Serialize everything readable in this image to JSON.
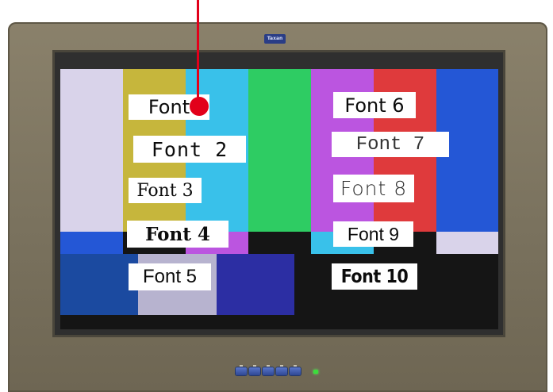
{
  "monitor": {
    "brand_logo": "Taxan",
    "bezel_color": "#7d7560"
  },
  "color_bars": {
    "top_row": [
      "#d9d3ea",
      "#c6b63c",
      "#39c1ea",
      "#2ecc63",
      "#bb55e0",
      "#df3a3c",
      "#2457d6"
    ],
    "middle_row": [
      "#2457d6",
      "#151515",
      "#bb55e0",
      "#151515",
      "#39c1ea",
      "#151515",
      "#d9d3ea"
    ],
    "bottom_blocks": [
      "#1b4aa0",
      "#b7b3cf",
      "#2c2ea3",
      "#151515"
    ]
  },
  "font_labels": {
    "font_1": "Font",
    "font_2": "Font 2",
    "font_3": "Font 3",
    "font_4": "Font 4",
    "font_5": "Font 5",
    "font_6": "Font 6",
    "font_7": "Font 7",
    "font_8": "Font 8",
    "font_9": "Font 9",
    "font_10": "Font 10"
  },
  "marker": {
    "color": "#e2001a"
  },
  "power_indicator_color": "#3cdd3c"
}
